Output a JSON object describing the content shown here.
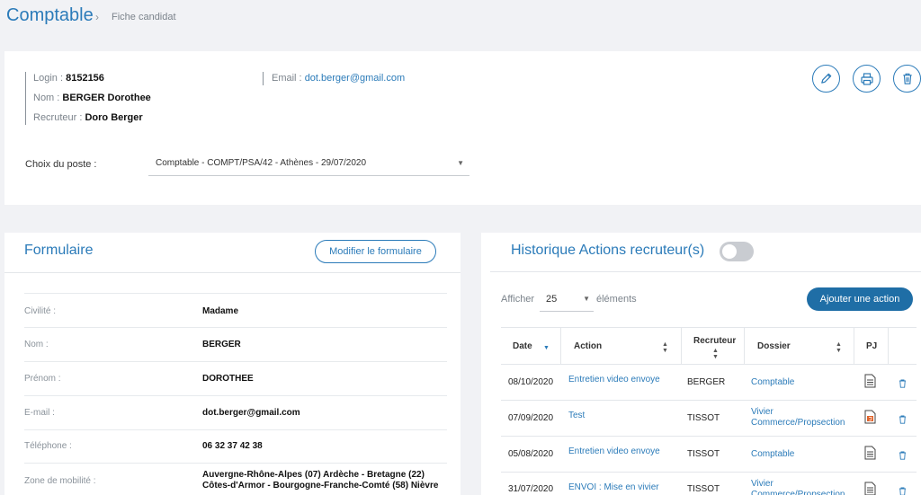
{
  "breadcrumb": {
    "title": "Comptable",
    "separator": "›",
    "subtitle": "Fiche candidat"
  },
  "candidate": {
    "login_label": "Login : ",
    "login_value": "8152156",
    "nom_label": "Nom : ",
    "nom_value": "BERGER Dorothee",
    "recruteur_label": "Recruteur : ",
    "recruteur_value": "Doro Berger",
    "email_label": "Email : ",
    "email_value": "dot.berger@gmail.com"
  },
  "actions": {
    "edit_icon": "pencil-icon",
    "print_icon": "printer-icon",
    "delete_icon": "trash-icon"
  },
  "poste": {
    "label": "Choix du poste :",
    "selected": "Comptable - COMPT/PSA/42 - Athènes - 29/07/2020"
  },
  "formulaire": {
    "title": "Formulaire",
    "modify_button": "Modifier le formulaire",
    "rows": [
      {
        "label": "Civilité :",
        "value": "Madame"
      },
      {
        "label": "Nom :",
        "value": "BERGER"
      },
      {
        "label": "Prénom :",
        "value": "DOROTHEE"
      },
      {
        "label": "E-mail :",
        "value": "dot.berger@gmail.com"
      },
      {
        "label": "Téléphone :",
        "value": "06 32 37 42 38"
      },
      {
        "label": "Zone de mobilité :",
        "value": "Auvergne-Rhône-Alpes (07) Ardèche - Bretagne (22) Côtes-d'Armor - Bourgogne-Franche-Comté (58) Nièvre"
      }
    ]
  },
  "historique": {
    "title": "Historique Actions recruteur(s)",
    "toggle_on": false,
    "afficher": "Afficher",
    "page_size": "25",
    "elements": "éléments",
    "add_button": "Ajouter une action",
    "columns": {
      "date": "Date",
      "action": "Action",
      "recruteur": "Recruteur",
      "dossier": "Dossier",
      "pj": "PJ"
    },
    "rows": [
      {
        "date": "08/10/2020",
        "action": "Entretien video envoye",
        "recruteur": "BERGER",
        "dossier": "Comptable",
        "pj": "document-icon"
      },
      {
        "date": "07/09/2020",
        "action": "Test",
        "recruteur": "TISSOT",
        "dossier": "Vivier Commerce/Propsection",
        "pj": "html-file-icon"
      },
      {
        "date": "05/08/2020",
        "action": "Entretien video envoye",
        "recruteur": "TISSOT",
        "dossier": "Comptable",
        "pj": "document-icon"
      },
      {
        "date": "31/07/2020",
        "action": "ENVOI : Mise en vivier",
        "recruteur": "TISSOT",
        "dossier": "Vivier Commerce/Propsection",
        "pj": "document-icon"
      }
    ]
  },
  "colors": {
    "accent": "#2b7bb9",
    "primary_button": "#1f6ea6",
    "background": "#f1f2f5",
    "pj_html": "#e0642c"
  }
}
